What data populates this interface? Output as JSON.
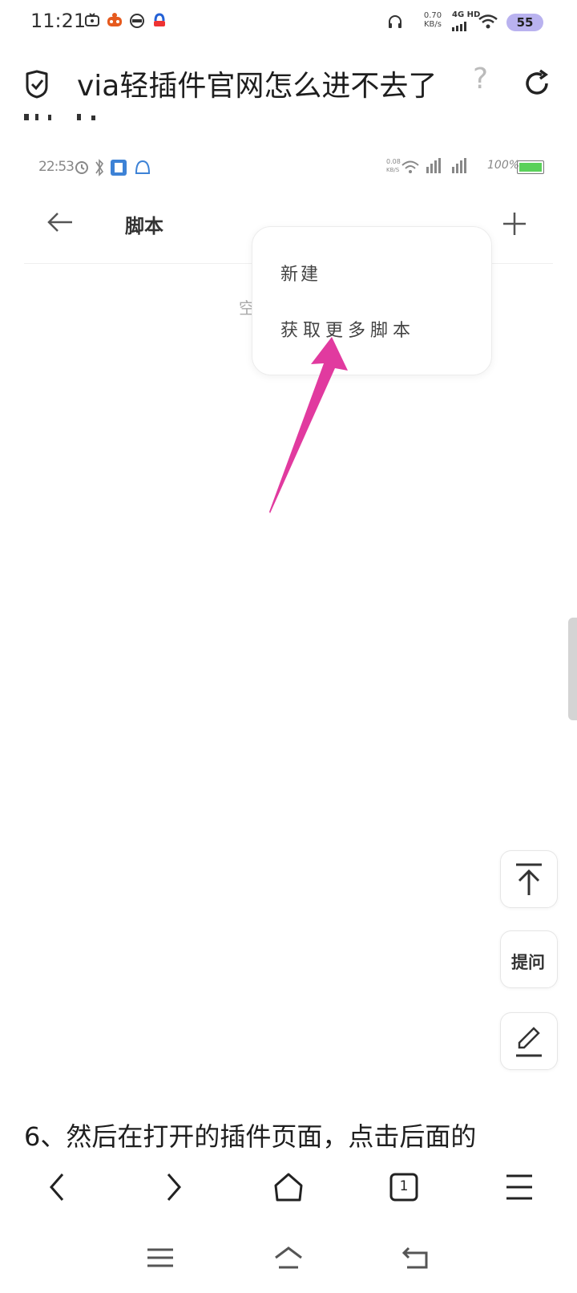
{
  "status_bar": {
    "time": "11:21",
    "net_speed_value": "0.70",
    "net_speed_unit": "KB/s",
    "network_type": "4G HD",
    "battery": "55"
  },
  "header": {
    "title": "via轻插件官网怎么进不去了",
    "title_suffix": "?"
  },
  "embedded": {
    "time": "22:53",
    "battery_text": "100%",
    "page_title": "脚本",
    "empty_text": "空",
    "menu": {
      "new_label": "新建",
      "more_label": "获取更多脚本"
    }
  },
  "floating": {
    "ask_label": "提问"
  },
  "article": {
    "text": "6、然后在打开的插件页面，点击后面的"
  },
  "toolbar": {
    "tab_count": "1"
  },
  "colors": {
    "accent_arrow": "#e13a9f",
    "battery_pill": "#b9b2ef"
  }
}
